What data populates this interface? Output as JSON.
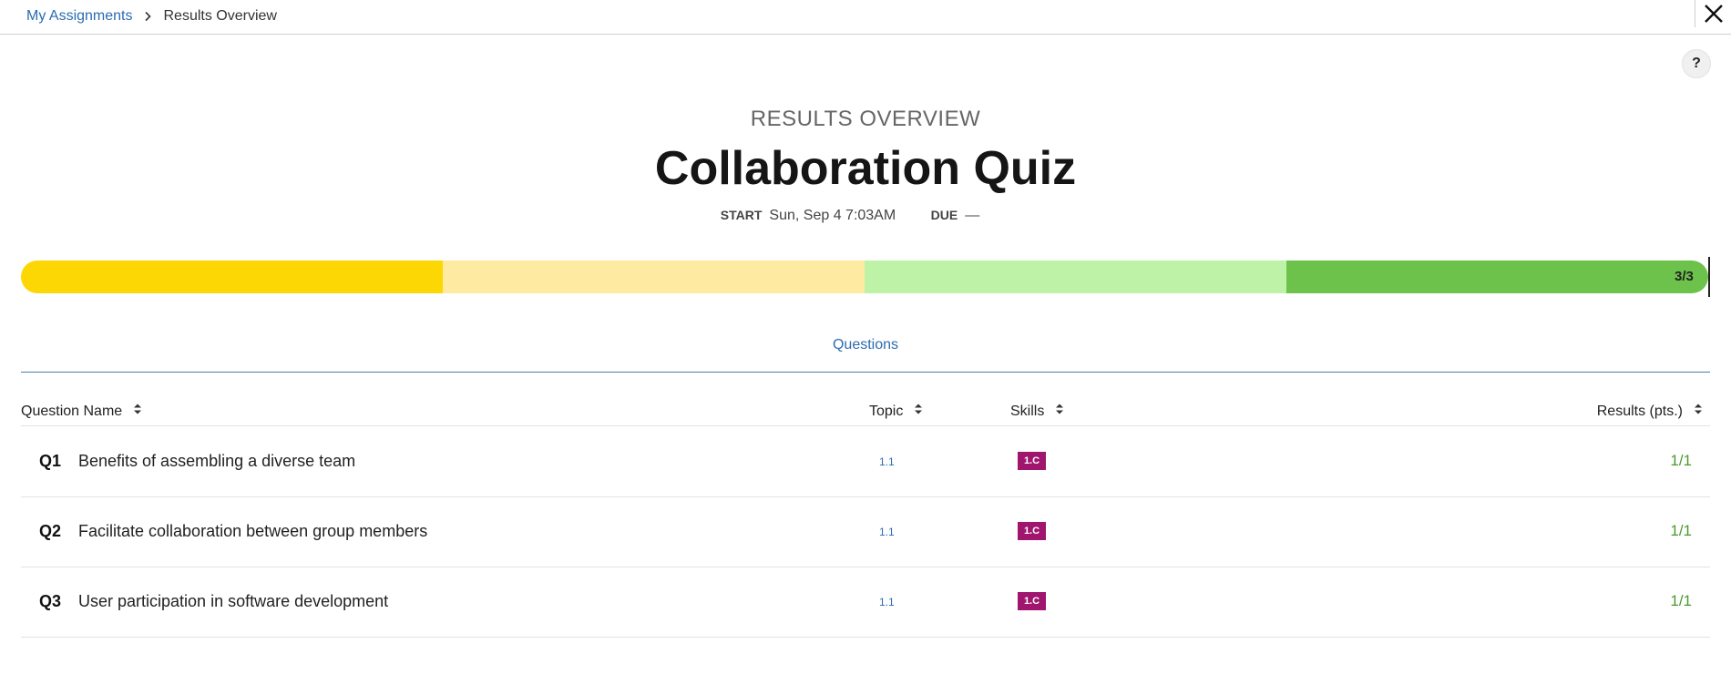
{
  "breadcrumb": {
    "parent": "My Assignments",
    "current": "Results Overview"
  },
  "icons": {
    "close": "close-icon",
    "help": "help-icon",
    "sort": "sort-icon",
    "chevron": "chevron-right-icon"
  },
  "help_label": "?",
  "header": {
    "kicker": "RESULTS OVERVIEW",
    "title": "Collaboration Quiz",
    "start_label": "START",
    "start_value": "Sun, Sep 4 7:03AM",
    "due_label": "DUE",
    "due_value": "—"
  },
  "progress": {
    "label": "3/3",
    "segments": [
      "#fcd703",
      "#feeaa0",
      "#bdf2a7",
      "#6cc24a"
    ]
  },
  "tabs": {
    "questions": "Questions"
  },
  "table": {
    "columns": {
      "question_name": "Question Name",
      "topic": "Topic",
      "skills": "Skills",
      "results": "Results (pts.)"
    },
    "rows": [
      {
        "num": "Q1",
        "name": "Benefits of assembling a diverse team",
        "topic": "1.1",
        "skill": "1.C",
        "result": "1/1"
      },
      {
        "num": "Q2",
        "name": "Facilitate collaboration between group members",
        "topic": "1.1",
        "skill": "1.C",
        "result": "1/1"
      },
      {
        "num": "Q3",
        "name": "User participation in software development",
        "topic": "1.1",
        "skill": "1.C",
        "result": "1/1"
      }
    ]
  },
  "colors": {
    "link": "#2b6cb0",
    "skill_badge": "#a0166f",
    "result": "#4a9a2e"
  }
}
